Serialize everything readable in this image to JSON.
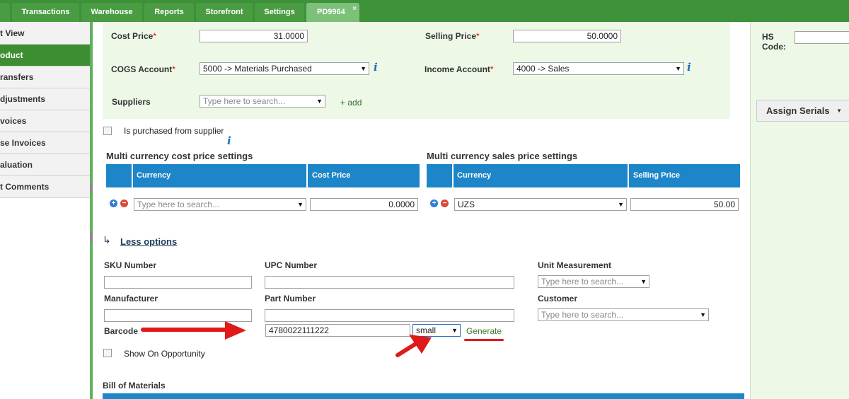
{
  "nav": {
    "tabs": [
      {
        "label": "Transactions"
      },
      {
        "label": "Warehouse"
      },
      {
        "label": "Reports"
      },
      {
        "label": "Storefront"
      },
      {
        "label": "Settings"
      },
      {
        "label": "PD9964",
        "close": "×"
      }
    ]
  },
  "sidebar": {
    "items": [
      {
        "label": "t View"
      },
      {
        "label": "oduct"
      },
      {
        "label": "ransfers"
      },
      {
        "label": "djustments"
      },
      {
        "label": "voices"
      },
      {
        "label": "se Invoices"
      },
      {
        "label": "aluation"
      },
      {
        "label": "t Comments"
      }
    ]
  },
  "pricing": {
    "cost_price_label": "Cost Price",
    "cost_price_value": "31.0000",
    "selling_price_label": "Selling Price",
    "selling_price_value": "50.0000",
    "cogs_label": "COGS Account",
    "cogs_value": "5000 -> Materials Purchased",
    "income_label": "Income Account",
    "income_value": "4000 -> Sales",
    "suppliers_label": "Suppliers",
    "suppliers_placeholder": "Type here to search...",
    "add_link": "+ add",
    "required_mark": "*",
    "info_glyph": "i"
  },
  "purchased_checkbox_label": "Is purchased from supplier",
  "multi_cost": {
    "title": "Multi currency cost price settings",
    "col_currency": "Currency",
    "col_price": "Cost Price",
    "currency_placeholder": "Type here to search...",
    "price_value": "0.0000"
  },
  "multi_sales": {
    "title": "Multi currency sales price settings",
    "col_currency": "Currency",
    "col_price": "Selling Price",
    "currency_value": "UZS",
    "price_value": "50.00"
  },
  "less_options": {
    "arrow": "↳",
    "label": "Less options"
  },
  "fields": {
    "sku_label": "SKU Number",
    "upc_label": "UPC Number",
    "unit_label": "Unit Measurement",
    "unit_placeholder": "Type here to search...",
    "manufacturer_label": "Manufacturer",
    "part_label": "Part Number",
    "customer_label": "Customer",
    "customer_placeholder": "Type here to search...",
    "barcode_label": "Barcode",
    "barcode_value": "4780022111222",
    "barcode_size": "small",
    "generate_link": "Generate",
    "show_opportunity_label": "Show On Opportunity"
  },
  "bom_title": "Bill of Materials",
  "right_panel": {
    "hs_label": "HS Code:",
    "assign_serials": "Assign Serials"
  },
  "colors": {
    "nav_green": "#3d9138",
    "header_blue": "#1d86c8",
    "panel_green": "#eef8e7",
    "annotation_red": "#e01a1a"
  }
}
